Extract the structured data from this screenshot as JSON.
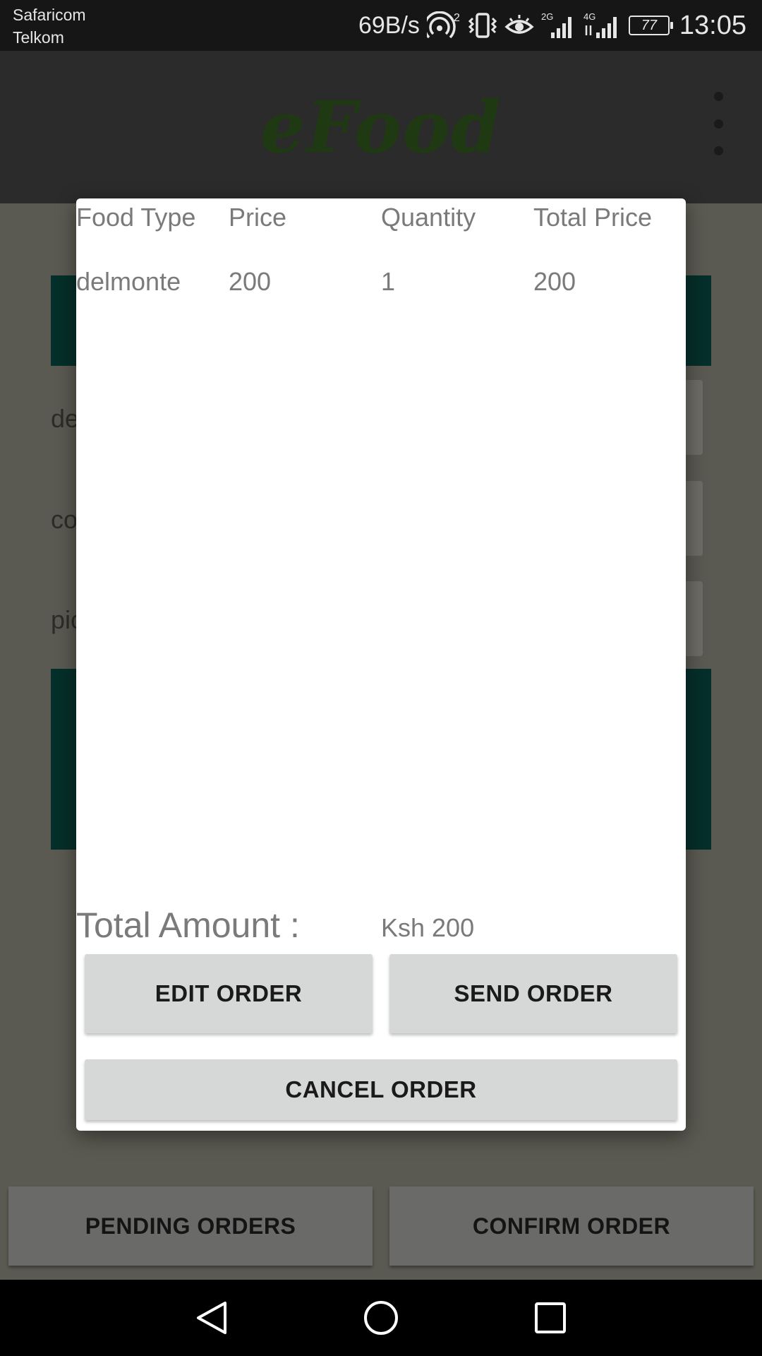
{
  "status_bar": {
    "carrier_1": "Safaricom",
    "carrier_2": "Telkom",
    "net_speed": "69B/s",
    "hotspot_badge": "2",
    "signal_1_label": "2G",
    "signal_2_label": "4G",
    "battery": "77",
    "time": "13:05"
  },
  "app_bar": {
    "logo": "eFood",
    "logo_color": "#1f3a12"
  },
  "background": {
    "row_texts": [
      "de",
      "co",
      "pic"
    ]
  },
  "bottom_buttons": {
    "pending": "PENDING ORDERS",
    "confirm": "CONFIRM ORDER"
  },
  "dialog": {
    "columns": [
      "Food Type",
      "Price",
      "Quantity",
      "Total Price"
    ],
    "rows": [
      [
        "delmonte",
        "200",
        "1",
        "200"
      ]
    ],
    "total_label": "Total Amount :",
    "total_value": "Ksh 200",
    "edit_button": "EDIT ORDER",
    "send_button": "SEND ORDER",
    "cancel_button": "CANCEL ORDER"
  },
  "colors": {
    "teal": "#052f2a",
    "dialog_button": "#d6d7d7"
  }
}
